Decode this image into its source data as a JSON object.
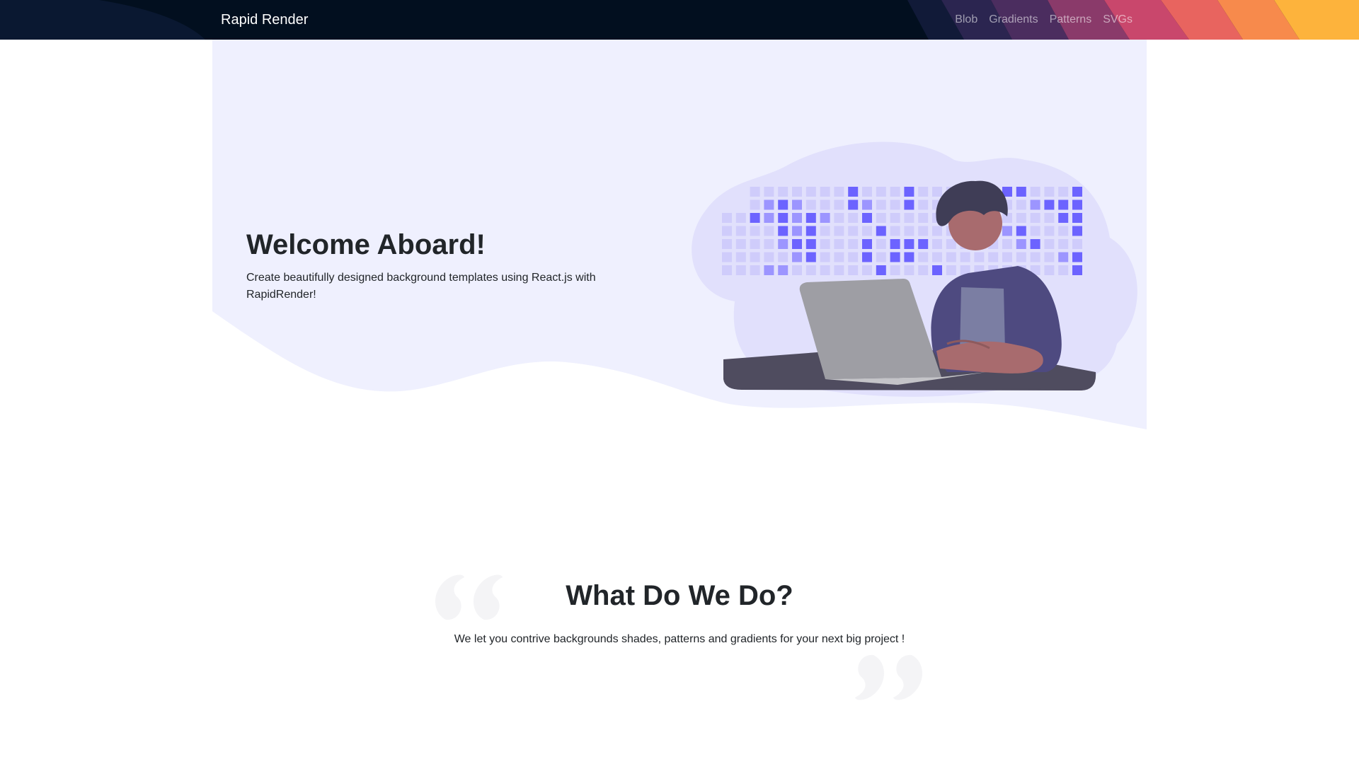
{
  "navbar": {
    "brand": "Rapid Render",
    "links": [
      {
        "label": "Blob"
      },
      {
        "label": "Gradients"
      },
      {
        "label": "Patterns"
      },
      {
        "label": "SVGs"
      }
    ],
    "background": "#020f1f",
    "stripe_colors": [
      "#1d1d3f",
      "#4a2d5e",
      "#a13d6b",
      "#d94f6a",
      "#f0725a",
      "#fb9745",
      "#fdb43a"
    ]
  },
  "hero": {
    "title": "Welcome Aboard!",
    "subtitle": "Create beautifully designed background templates using React.js with RapidRender!",
    "background_color": "#eff0fe",
    "illustration": "man-with-laptop-illustration"
  },
  "what": {
    "title": "What Do We Do?",
    "subtitle": "We let you contrive backgrounds shades, patterns and gradients for your next big project !",
    "decorations": [
      "open-quote-icon",
      "close-quote-icon"
    ]
  }
}
